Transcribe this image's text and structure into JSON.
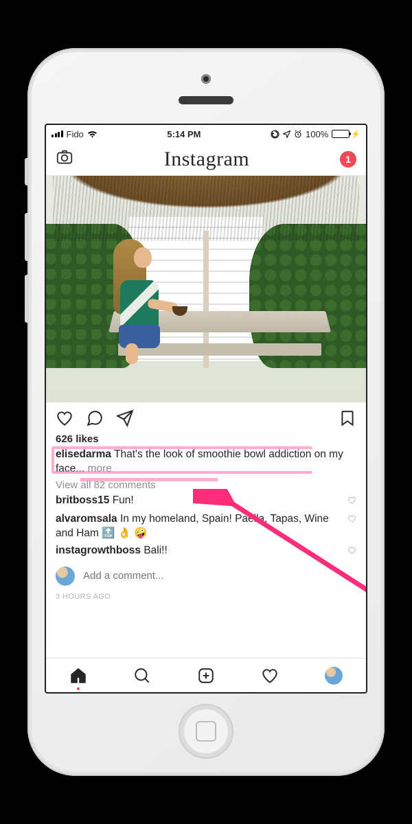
{
  "status": {
    "carrier": "Fido",
    "time": "5:14 PM",
    "battery_pct": "100%"
  },
  "header": {
    "logo": "Instagram",
    "notif_count": "1"
  },
  "post": {
    "likes": "626 likes",
    "author": "elisedarma",
    "caption_text": "That's the look of smoothie bowl addiction on my face... ",
    "more": "more",
    "view_all": "View all 82 comments",
    "comments": [
      {
        "user": "britboss15",
        "text": "Fun!"
      },
      {
        "user": "alvaromsala",
        "text": "In my homeland, Spain! Paella, Tapas, Wine and Ham 🔝 👌 🤪"
      },
      {
        "user": "instagrowthboss",
        "text": "Bali!!"
      }
    ],
    "add_placeholder": "Add a comment...",
    "timestamp": "3 HOURS AGO"
  }
}
